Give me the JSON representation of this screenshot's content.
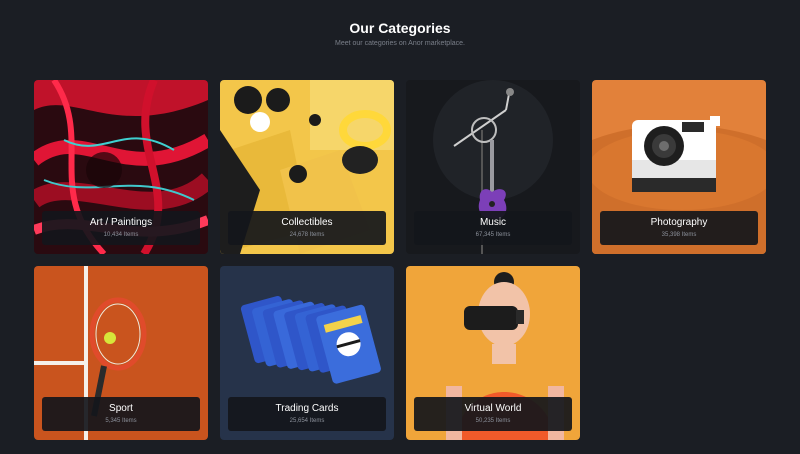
{
  "header": {
    "title": "Our Categories",
    "subtitle": "Meet our categories on Anor marketplace."
  },
  "categories": [
    {
      "title": "Art / Paintings",
      "count": "10,434 Items",
      "icon": "abstract-art-image"
    },
    {
      "title": "Collectibles",
      "count": "24,678 Items",
      "icon": "collectibles-3d-image"
    },
    {
      "title": "Music",
      "count": "67,345 Items",
      "icon": "guitar-microphone-image"
    },
    {
      "title": "Photography",
      "count": "35,398 Items",
      "icon": "camera-image"
    },
    {
      "title": "Sport",
      "count": "5,345 Items",
      "icon": "tennis-racket-image"
    },
    {
      "title": "Trading Cards",
      "count": "25,654 Items",
      "icon": "trading-cards-image"
    },
    {
      "title": "Virtual World",
      "count": "50,235 Items",
      "icon": "vr-headset-image"
    }
  ],
  "colors": {
    "background": "#1b1e24",
    "label_background": "#14161b",
    "title_text": "#ffffff",
    "muted_text": "#8c919b"
  }
}
